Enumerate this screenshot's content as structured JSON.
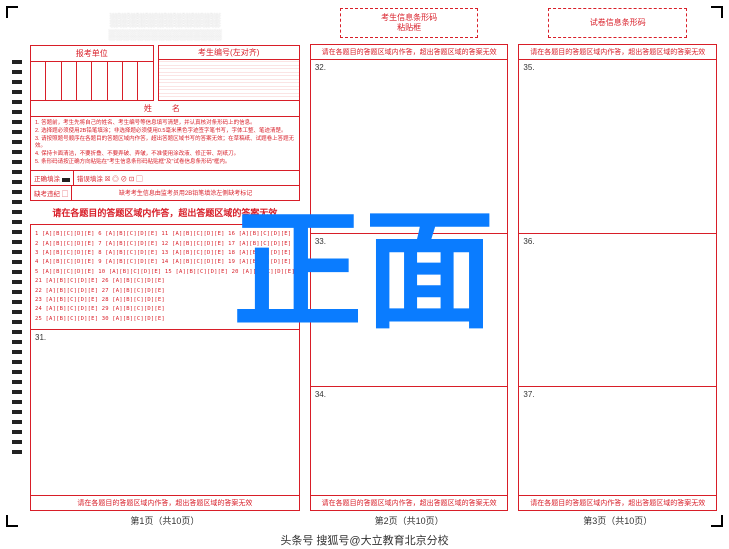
{
  "page_titles": [
    "第1页（共10页）",
    "第2页（共10页）",
    "第3页（共10页）"
  ],
  "barcode_boxes": [
    {
      "line1": "考生信息条形码",
      "line2": "粘贴框"
    },
    {
      "line1": "试卷信息条形码",
      "line2": ""
    }
  ],
  "p1": {
    "title": "░░░░░░░░░░░░",
    "subtitle": "░░░░░░░░░░░░░░░░",
    "unit_hdr": "报考单位",
    "ticket_hdr": "考生编号(左对齐)",
    "name_label": "姓　名",
    "instructions": [
      "1. 答题前，考生先将自己的姓名、考生编号等信息填写清楚，并认真核对条形码上的信息。",
      "2. 选择题必须使用2B铅笔填涂；非选择题必须使用0.5毫米黑色字迹签字笔书写，字体工整、笔迹清楚。",
      "3. 请按照题号顺序在各题目的答题区域内作答，超出答题区域书写的答案无效；在草稿纸、试题卷上答题无效。",
      "4. 保持卡面清洁，不要折叠、不要弄破、弄皱，不准使用涂改液、修正带、刮纸刀。",
      "5. 条形码请按正确方向粘贴在\"考生信息条形码粘贴框\"及\"试卷信息条形码\"框内。"
    ],
    "mark_correct": "正确填涂",
    "mark_wrong": "错误填涂",
    "mark_samples": "☒ ◎ ⊘ ⊡ ▢",
    "absent": "缺考违纪",
    "absent_note": "缺考考生信息由监考员用2B铅笔填涂左侧缺考标记",
    "warn": "请在各题目的答题区域内作答，超出答题区域的答案无效",
    "mc_rows": [
      "1 [A][B][C][D][E] 6 [A][B][C][D][E] 11 [A][B][C][D][E] 16 [A][B][C][D][E]",
      "2 [A][B][C][D][E] 7 [A][B][C][D][E] 12 [A][B][C][D][E] 17 [A][B][C][D][E]",
      "3 [A][B][C][D][E] 8 [A][B][C][D][E] 13 [A][B][C][D][E] 18 [A][B][C][D][E]",
      "4 [A][B][C][D][E] 9 [A][B][C][D][E] 14 [A][B][C][D][E] 19 [A][B][C][D][E]",
      "5 [A][B][C][D][E] 10 [A][B][C][D][E] 15 [A][B][C][D][E] 20 [A][B][C][D][E]",
      "",
      "21 [A][B][C][D][E] 26 [A][B][C][D][E]",
      "22 [A][B][C][D][E] 27 [A][B][C][D][E]",
      "23 [A][B][C][D][E] 28 [A][B][C][D][E]",
      "24 [A][B][C][D][E] 29 [A][B][C][D][E]",
      "25 [A][B][C][D][E] 30 [A][B][C][D][E]"
    ],
    "q31": "31.",
    "foot_warn": "请在各题目的答题区域内作答，超出答题区域的答案无效"
  },
  "ans_header": "请在各题目的答题区域内作答，超出答题区域的答案无效",
  "ans_footer": "请在各题目的答题区域内作答，超出答题区域的答案无效",
  "p2_q": [
    "32.",
    "33.",
    "34."
  ],
  "p3_q": [
    "35.",
    "36.",
    "37."
  ],
  "watermark": "正面",
  "credit": "头条号 搜狐号@大立教育北京分校"
}
